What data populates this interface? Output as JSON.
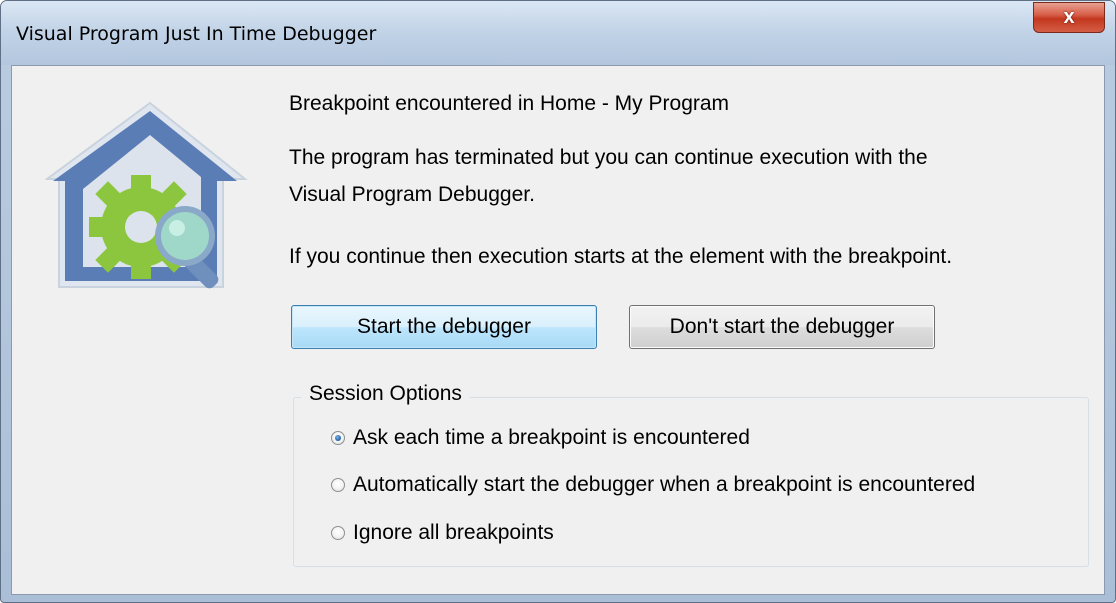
{
  "window": {
    "title": "Visual Program Just In Time Debugger",
    "close_symbol": "x"
  },
  "icon": {
    "name": "debugger-house-gear-magnifier-icon",
    "colors": {
      "house": "#5b7db5",
      "gear": "#8cc63f",
      "magnifier_rim": "#8aa8c8",
      "magnifier_lens": "#9fd8c8"
    }
  },
  "message": {
    "line1": "Breakpoint encountered in Home - My Program",
    "line2": "The program has terminated but you can continue execution with the",
    "line3": "Visual Program Debugger.",
    "line4": "If you continue then execution starts at the element with the breakpoint."
  },
  "buttons": {
    "start": "Start the debugger",
    "dont_start": "Don't start the debugger"
  },
  "session_options": {
    "legend": "Session Options",
    "options": [
      {
        "label": "Ask each time a breakpoint is encountered",
        "checked": true
      },
      {
        "label": "Automatically start the debugger when a breakpoint is encountered",
        "checked": false
      },
      {
        "label": "Ignore all breakpoints",
        "checked": false
      }
    ]
  }
}
